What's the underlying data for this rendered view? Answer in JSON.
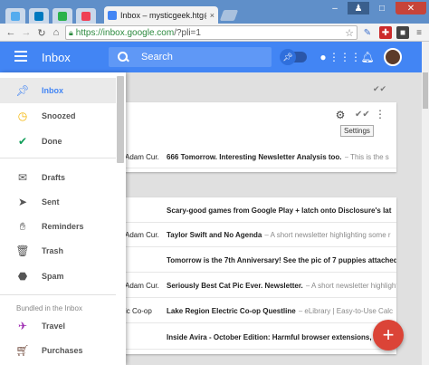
{
  "browser": {
    "tab_title": "Inbox – mysticgeek.htg@",
    "tab_close": "×",
    "url_host": "https://inbox.google.com",
    "url_rest": "/?pli=1",
    "win_close": "✕"
  },
  "appbar": {
    "title": "Inbox",
    "search_placeholder": "Search"
  },
  "sidebar": {
    "items": [
      {
        "label": "Inbox",
        "icon": "pin-icon",
        "active": true
      },
      {
        "label": "Snoozed",
        "icon": "clock-icon"
      },
      {
        "label": "Done",
        "icon": "check-icon"
      },
      {
        "label": "Drafts",
        "icon": "drafts-icon"
      },
      {
        "label": "Sent",
        "icon": "send-icon"
      },
      {
        "label": "Reminders",
        "icon": "reminder-hand-icon"
      },
      {
        "label": "Trash",
        "icon": "trash-icon"
      },
      {
        "label": "Spam",
        "icon": "spam-icon"
      }
    ],
    "bundled_label": "Bundled in the Inbox",
    "bundles": [
      {
        "label": "Travel",
        "icon": "plane-icon"
      },
      {
        "label": "Purchases",
        "icon": "cart-icon"
      }
    ]
  },
  "bundle_card": {
    "tooltip": "Settings",
    "row": {
      "sender": "Adam Cur.",
      "subject": "666 Tomorrow. Interesting Newsletter Analysis too.",
      "snippet": "– This is the s"
    }
  },
  "messages": [
    {
      "sender": "",
      "subject": "Scary-good games from Google Play + latch onto Disclosure's lat",
      "snippet": ""
    },
    {
      "sender": "Adam Cur.",
      "subject": "Taylor Swift and No Agenda",
      "snippet": "– A short newsletter highlighting some r"
    },
    {
      "sender": "",
      "subject": "Tomorrow is the 7th Anniversary! See the pic of 7 puppies attached.",
      "snippet": ""
    },
    {
      "sender": "Adam Cur.",
      "subject": "Seriously Best Cat Pic Ever. Newsletter.",
      "snippet": "– A short newsletter highlightin"
    },
    {
      "sender": "ic Co-op",
      "subject": "Lake Region Electric Co-op Questline",
      "snippet": "– eLibrary | Easy-to-Use Calc"
    },
    {
      "sender": "",
      "subject": "Inside Avira - October Edition: Harmful browser extensions, smart",
      "snippet": ""
    }
  ],
  "colors": {
    "brand_blue": "#4285f4",
    "fab_red": "#db4437",
    "chrome_blue": "#5f8fc9"
  }
}
